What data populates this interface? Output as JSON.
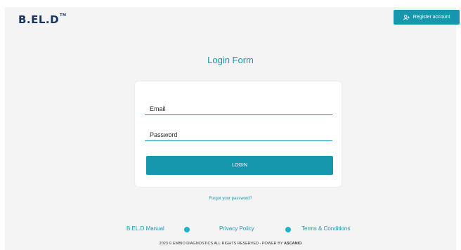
{
  "header": {
    "logo_text": "B.EL.D",
    "logo_mark": "TM",
    "register_label": "Register account",
    "register_icon": "user-add-icon"
  },
  "login": {
    "title": "Login Form",
    "email_placeholder": "Email",
    "password_placeholder": "Password",
    "login_label": "LOGIN",
    "forgot_label": "Forgot your password?"
  },
  "footer": {
    "links": [
      "B.EL.D Manual",
      "Privacy Policy",
      "Terms & Conditions"
    ],
    "copyright_prefix": "2023 © EMBIO DIAGNOSTICS ALL RIGHTS RESERVED - POWER BY",
    "copyright_brand": "ASCANIO"
  },
  "colors": {
    "accent": "#1797ad",
    "dot": "#1fb3c9",
    "logo": "#17355f",
    "background": "#f4f4f4"
  }
}
